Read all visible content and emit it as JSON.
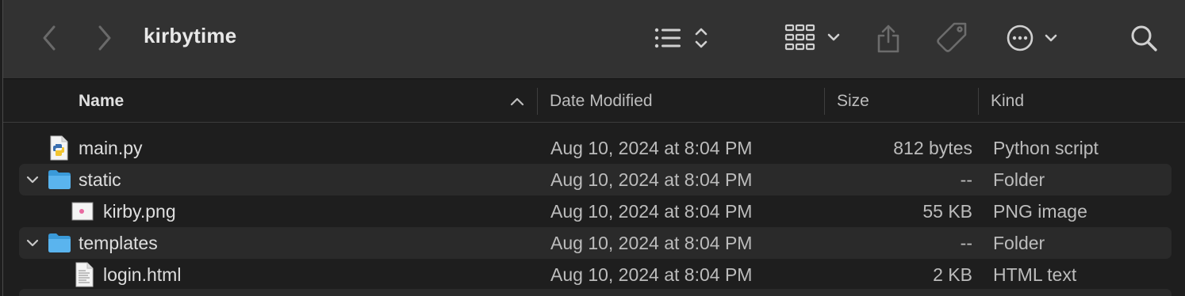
{
  "window": {
    "title": "kirbytime"
  },
  "toolbar": {
    "back_icon": "chevron-left-icon",
    "forward_icon": "chevron-right-icon",
    "list_view_icon": "list-view-icon",
    "grid_view_icon": "grid-view-icon",
    "share_icon": "share-icon",
    "tag_icon": "tag-icon",
    "more_icon": "ellipsis-circle-icon",
    "search_icon": "search-icon"
  },
  "columns": {
    "name": "Name",
    "date": "Date Modified",
    "size": "Size",
    "kind": "Kind",
    "sort": "ascending"
  },
  "files": [
    {
      "name": "main.py",
      "date": "Aug 10, 2024 at 8:04 PM",
      "size": "812 bytes",
      "kind": "Python script",
      "icon": "python-file-icon",
      "indent": 0,
      "expandable": false
    },
    {
      "name": "static",
      "date": "Aug 10, 2024 at 8:04 PM",
      "size": "--",
      "kind": "Folder",
      "icon": "folder-icon",
      "indent": 0,
      "expandable": true,
      "expanded": true
    },
    {
      "name": "kirby.png",
      "date": "Aug 10, 2024 at 8:04 PM",
      "size": "55 KB",
      "kind": "PNG image",
      "icon": "image-file-icon",
      "indent": 1,
      "expandable": false
    },
    {
      "name": "templates",
      "date": "Aug 10, 2024 at 8:04 PM",
      "size": "--",
      "kind": "Folder",
      "icon": "folder-icon",
      "indent": 0,
      "expandable": true,
      "expanded": true
    },
    {
      "name": "login.html",
      "date": "Aug 10, 2024 at 8:04 PM",
      "size": "2 KB",
      "kind": "HTML text",
      "icon": "html-file-icon",
      "indent": 1,
      "expandable": false
    }
  ]
}
